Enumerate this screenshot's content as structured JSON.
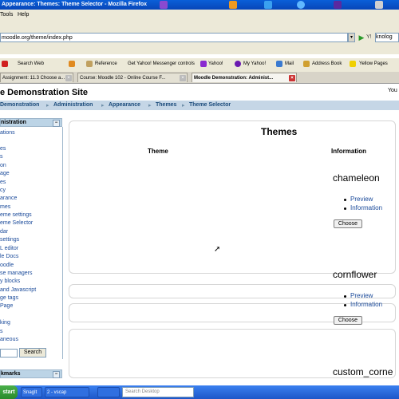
{
  "window": {
    "title": "Appearance: Themes: Theme Selector - Mozilla Firefox"
  },
  "menu": {
    "items": [
      "Tools",
      "Help"
    ]
  },
  "nav": {
    "url": "moodle.org/theme/index.php",
    "search_value": "knolog"
  },
  "yahoo_toolbar": {
    "items": [
      "Search Web",
      "Reference",
      "Get Yahoo! Messenger controls",
      "Yahoo!",
      "My Yahoo!",
      "Mail",
      "Address Book",
      "Yellow Pages"
    ]
  },
  "tabs": [
    {
      "label": "Assignment: 11.3 Choose a...",
      "active": false
    },
    {
      "label": "Course: Moodle 102 - Online Course F...",
      "active": false
    },
    {
      "label": "Moodle Demonstration: Administ...",
      "active": true
    }
  ],
  "page": {
    "site_title": "e Demonstration Site",
    "user_info": "You",
    "breadcrumb": [
      "Demonstration",
      "Administration",
      "Appearance",
      "Themes",
      "Theme Selector"
    ],
    "title": "Themes",
    "col_theme": "Theme",
    "col_info": "Information"
  },
  "sidebar": {
    "heading": "nistration",
    "items": [
      "ations",
      "es",
      "s",
      "on",
      "age",
      "es",
      "cy",
      "arance",
      "mes",
      "eme settings",
      "eme Selector",
      "dar",
      " settings",
      "L editor",
      "le Docs",
      "oodle",
      "se managers",
      "y blocks",
      "and Javascript",
      "ge tags",
      "Page",
      "",
      "king",
      "s",
      "aneous"
    ],
    "search_button": "Search",
    "bookmarks_heading": "kmarks"
  },
  "themes": [
    {
      "name": "chameleon",
      "links": [
        "Preview",
        "Information"
      ],
      "button": "Choose"
    },
    {
      "name": "cornflower",
      "links": [
        "Preview",
        "Information"
      ],
      "button": "Choose"
    },
    {
      "name": "custom_corne"
    }
  ],
  "taskbar": {
    "start": "start",
    "tasks": [
      "SnagIt",
      "2 - vscap",
      ""
    ],
    "search_placeholder": "Search Desktop"
  },
  "colors": {
    "nav_strip": "#c5d6e6",
    "link": "#1a4a9a",
    "title_bar": "#0a5fd8",
    "taskbar": "#2a64d8"
  }
}
